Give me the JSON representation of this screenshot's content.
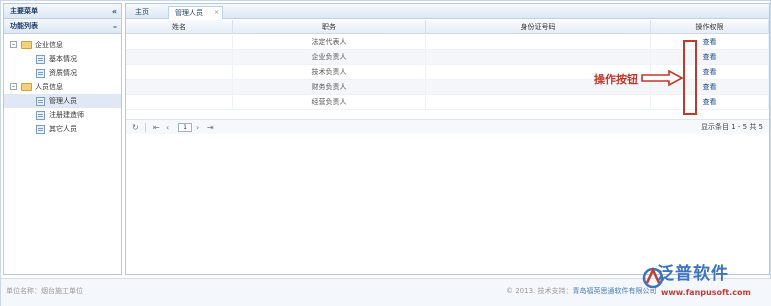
{
  "sidebar": {
    "title": "主要菜单",
    "collapse_icon": "«",
    "section_title": "功能列表",
    "section_collapse_icon": "–",
    "tree": [
      {
        "label": "企业信息",
        "toggle": "–",
        "children": [
          "基本情况",
          "资质情况"
        ]
      },
      {
        "label": "人员信息",
        "toggle": "–",
        "children": [
          "管理人员",
          "注册建造师",
          "其它人员"
        ]
      }
    ],
    "selected": "管理人员"
  },
  "tabs": [
    {
      "label": "主页"
    },
    {
      "label": "管理人员",
      "close": "×"
    }
  ],
  "grid": {
    "columns": [
      "姓名",
      "职务",
      "身份证号码",
      "操作权限"
    ],
    "rows": [
      {
        "name": "",
        "position": "法定代表人",
        "id": "",
        "action": "查看"
      },
      {
        "name": "",
        "position": "企业负责人",
        "id": "",
        "action": "查看"
      },
      {
        "name": "",
        "position": "技术负责人",
        "id": "",
        "action": "查看"
      },
      {
        "name": "",
        "position": "财务负责人",
        "id": "",
        "action": "查看"
      },
      {
        "name": "",
        "position": "经营负责人",
        "id": "",
        "action": "查看"
      }
    ]
  },
  "pager": {
    "refresh_icon": "↻",
    "first_icon": "⇤",
    "prev_icon": "‹",
    "page": "1",
    "next_icon": "›",
    "last_icon": "⇥",
    "info": "显示条目 1 - 5 共 5"
  },
  "annotation": {
    "label": "操作按钮",
    "color": "#c0392b"
  },
  "footer": {
    "unit": "单位名称：烟台施工单位",
    "copyright": "© 2013. 技术支持：",
    "company": "青岛福英思通软件有限公司"
  },
  "watermark": {
    "brand": "泛普软件",
    "url": "www.fanpusoft.com"
  },
  "colors": {
    "accent": "#1e3a5f",
    "link": "#1a4b8c",
    "annotation": "#c0392b",
    "brand_blue": "#3e73c0",
    "brand_red": "#c63b36"
  }
}
